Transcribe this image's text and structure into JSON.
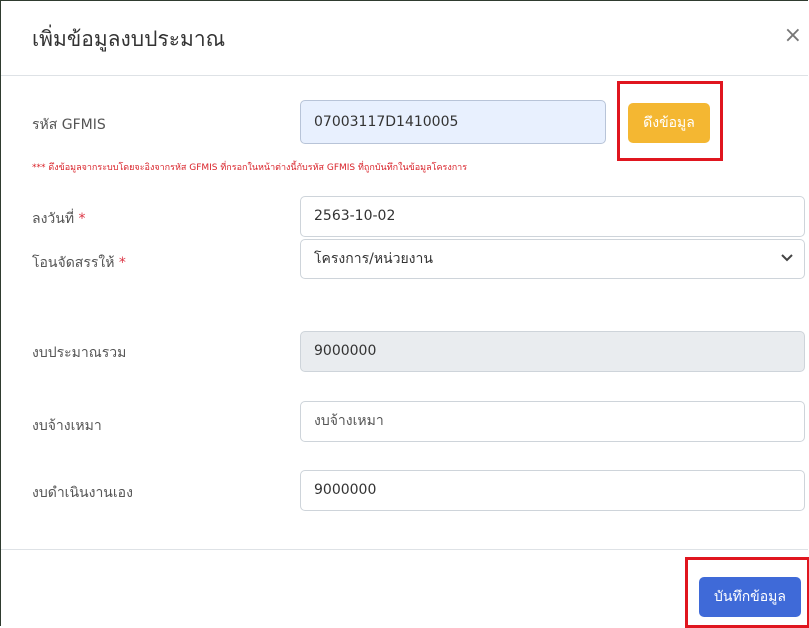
{
  "modal": {
    "title": "เพิ่มข้อมูลงบประมาณ",
    "close_symbol": "×"
  },
  "gfmis": {
    "label": "รหัส GFMIS",
    "value": "07003117D1410005",
    "fetch_button": "ดึงข้อมูล",
    "warning": "*** ดึงข้อมูลจากระบบโดยจะอิงจากรหัส GFMIS ที่กรอกในหน้าต่างนี้กับรหัส GFMIS ที่ถูกบันทึกในข้อมูลโครงการ"
  },
  "date": {
    "label": "ลงวันที่",
    "required_mark": "*",
    "value": "2563-10-02"
  },
  "transfer": {
    "label": "โอนจัดสรรให้",
    "required_mark": "*",
    "selected": "โครงการ/หน่วยงาน"
  },
  "total_budget": {
    "label": "งบประมาณรวม",
    "value": "9000000"
  },
  "outsource_budget": {
    "label": "งบจ้างเหมา",
    "placeholder": "งบจ้างเหมา"
  },
  "self_budget": {
    "label": "งบดำเนินงานเอง",
    "value": "9000000"
  },
  "footer": {
    "save_button": "บันทึกข้อมูล"
  },
  "colors": {
    "fetch_button": "#f4b732",
    "save_button": "#3f6ad8",
    "highlight": "#e0161f",
    "required": "#dc3545"
  },
  "icons": {
    "close": "close-icon",
    "select_arrow": "chevron-down-icon"
  }
}
